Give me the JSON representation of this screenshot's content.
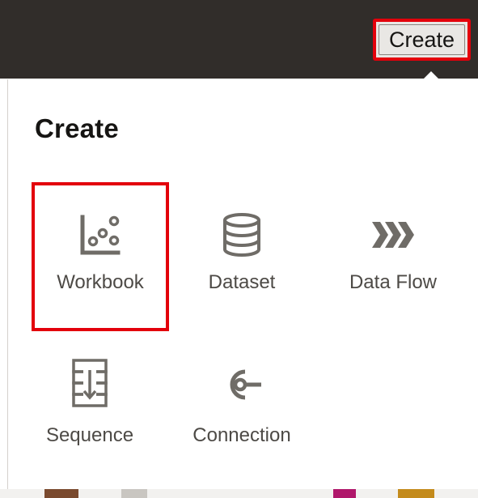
{
  "header": {
    "create_button_label": "Create"
  },
  "panel": {
    "title": "Create",
    "items": [
      {
        "label": "Workbook",
        "icon": "workbook-chart-icon",
        "selected": true
      },
      {
        "label": "Dataset",
        "icon": "database-icon",
        "selected": false
      },
      {
        "label": "Data Flow",
        "icon": "data-flow-chevrons-icon",
        "selected": false
      },
      {
        "label": "Sequence",
        "icon": "sequence-icon",
        "selected": false
      },
      {
        "label": "Connection",
        "icon": "connection-icon",
        "selected": false
      }
    ]
  },
  "colors": {
    "topbar": "#312d2a",
    "highlight": "#e3000b",
    "icon": "#6f6c67",
    "text": "#4d4a46"
  }
}
